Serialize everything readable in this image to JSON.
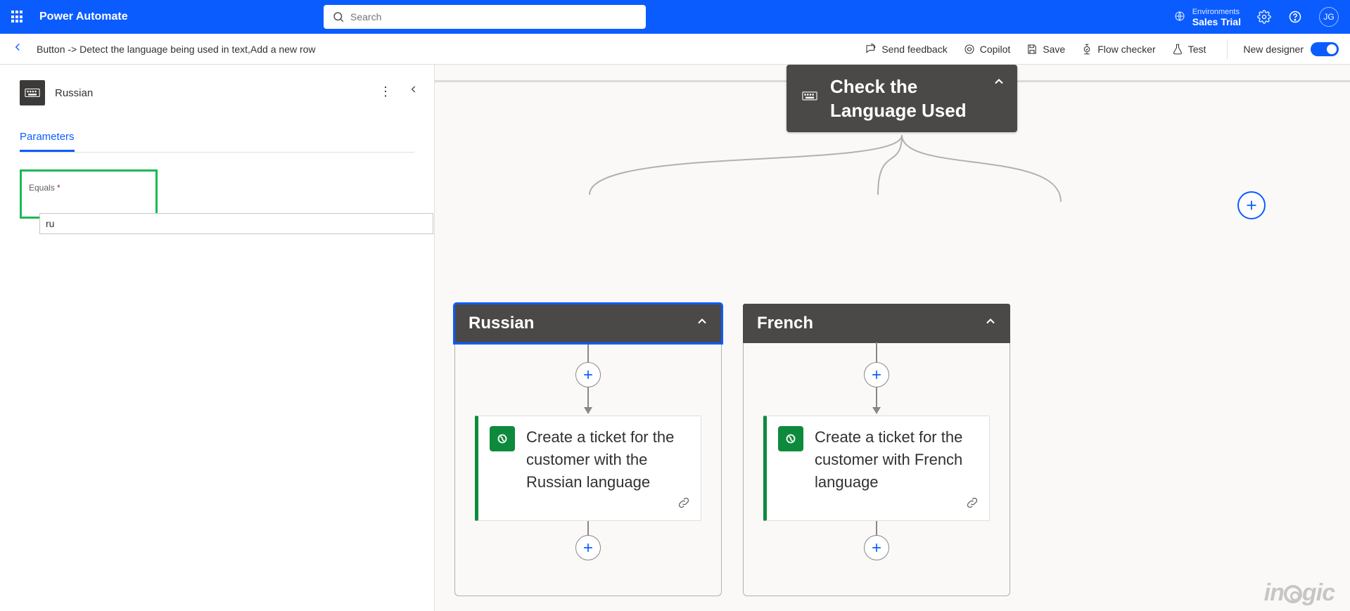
{
  "header": {
    "brand": "Power Automate",
    "search_placeholder": "Search",
    "environment_label": "Environments",
    "environment_name": "Sales Trial",
    "avatar": "JG"
  },
  "toolbar": {
    "breadcrumb": "Button -> Detect the language being used in text,Add a new row",
    "feedback": "Send feedback",
    "copilot": "Copilot",
    "save": "Save",
    "checker": "Flow checker",
    "test": "Test",
    "new_designer": "New designer"
  },
  "panel": {
    "title": "Russian",
    "tab": "Parameters",
    "field_label": "Equals",
    "field_required": "*",
    "field_value": "ru"
  },
  "canvas": {
    "switch_title": "Check the Language Used",
    "branches": [
      {
        "label": "Russian",
        "action": "Create a ticket for the customer with the Russian language",
        "selected": true
      },
      {
        "label": "French",
        "action": "Create a ticket for the customer with French language",
        "selected": false
      }
    ],
    "watermark": "inogic"
  }
}
